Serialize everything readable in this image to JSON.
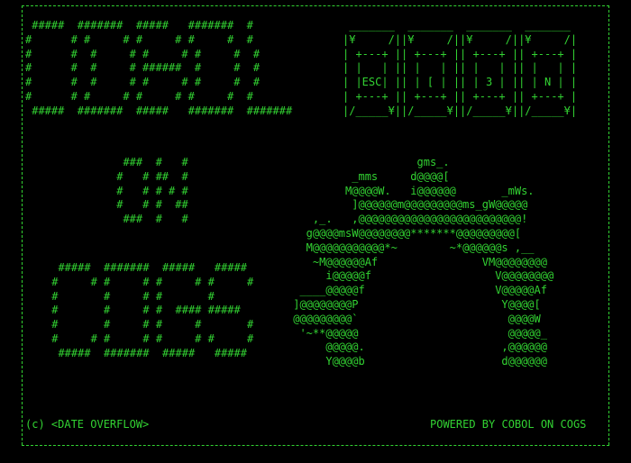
{
  "theme": {
    "foreground": "#32d232",
    "background": "#000000"
  },
  "title_art": " #####  #######  #####   #######  #\n#      # #     # #     # #     #  #\n#      #  #     # #     # #     #  #\n#      #  #     # ######  #     #  #\n#      #  #     # #     # #     #  #\n#      # #     # #     # #     #  #\n #####  #######  #####   #######  #######",
  "keys_art": " _______  _______  _______  _______\n|¥     /||¥     /||¥     /||¥     /|\n| +---+ || +---+ || +---+ || +---+ |\n| |   | || |   | || |   | || |   | |\n| |ESC| || | [ | || | 3 | || | N | |\n| +---+ || +---+ || +---+ || +---+ |\n|/_____¥||/_____¥||/_____¥||/_____¥|",
  "on_art": "  ###  #   #\n #   # ##  #\n #   # # # #\n #   # #  ##\n  ###  #   #",
  "cogs_art": "  #####  #######  #####   #####\n #     # #     # #     # #     #\n #       #     # #       #\n #       #     # #  #### #####\n #       #     # #     #       #\n #     # #     # #     # #     #\n  #####  #######  #####   #####",
  "arch_art": "                    gms_.\n          _mms     d@@@@[\n         M@@@@W.   i@@@@@@       _mWs.\n          ]@@@@@@m@@@@@@@@@ms_gW@@@@@\n    ,_.   ,@@@@@@@@@@@@@@@@@@@@@@@@@!\n   g@@@@msW@@@@@@@@*******@@@@@@@@@[\n   M@@@@@@@@@@@*~        ~*@@@@@@s ,__\n    ~M@@@@@@Af                VM@@@@@@@@\n      i@@@@@f                   V@@@@@@@@\n  ____@@@@@f                    V@@@@@Af\n ]@@@@@@@@P                      Y@@@@[\n @@@@@@@@@`                       @@@@W\n  '~**@@@@@                       @@@@@_\n      @@@@@.                     ,@@@@@@\n      Y@@@@b                     d@@@@@@",
  "footer": {
    "copyright": "(c) <DATE OVERFLOW>",
    "powered_by": "POWERED BY COBOL ON COGS"
  }
}
